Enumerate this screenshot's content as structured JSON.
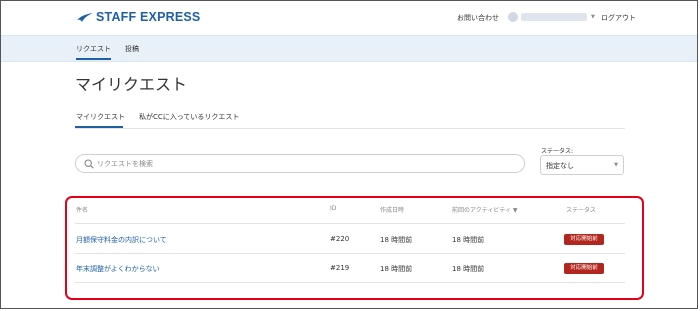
{
  "brand": {
    "name": "STAFF EXPRESS",
    "accent": "#1f5fa8"
  },
  "header": {
    "contact_label": "お問い合わせ",
    "logout_label": "ログアウト"
  },
  "nav": {
    "items": [
      {
        "label": "リクエスト",
        "active": true
      },
      {
        "label": "投稿",
        "active": false
      }
    ]
  },
  "main": {
    "title": "マイリクエスト",
    "tabs": [
      {
        "label": "マイリクエスト",
        "active": true
      },
      {
        "label": "私がCCに入っているリクエスト",
        "active": false
      }
    ],
    "search": {
      "placeholder": "リクエストを検索",
      "value": ""
    },
    "status_filter": {
      "label": "ステータス:",
      "selected": "指定なし"
    }
  },
  "table": {
    "columns": {
      "subject": "件名",
      "id": "ID",
      "created": "作成日時",
      "last_activity": "前回のアクティビティ ▼",
      "status": "ステータス"
    },
    "rows": [
      {
        "subject": "月額保守料金の内訳について",
        "id": "#220",
        "created": "18 時間前",
        "last_activity": "18 時間前",
        "status": "対応開始前"
      },
      {
        "subject": "年末調整がよくわからない",
        "id": "#219",
        "created": "18 時間前",
        "last_activity": "18 時間前",
        "status": "対応開始前"
      }
    ],
    "status_badge_color": "#b3261e",
    "highlight_color": "#e6001a"
  }
}
